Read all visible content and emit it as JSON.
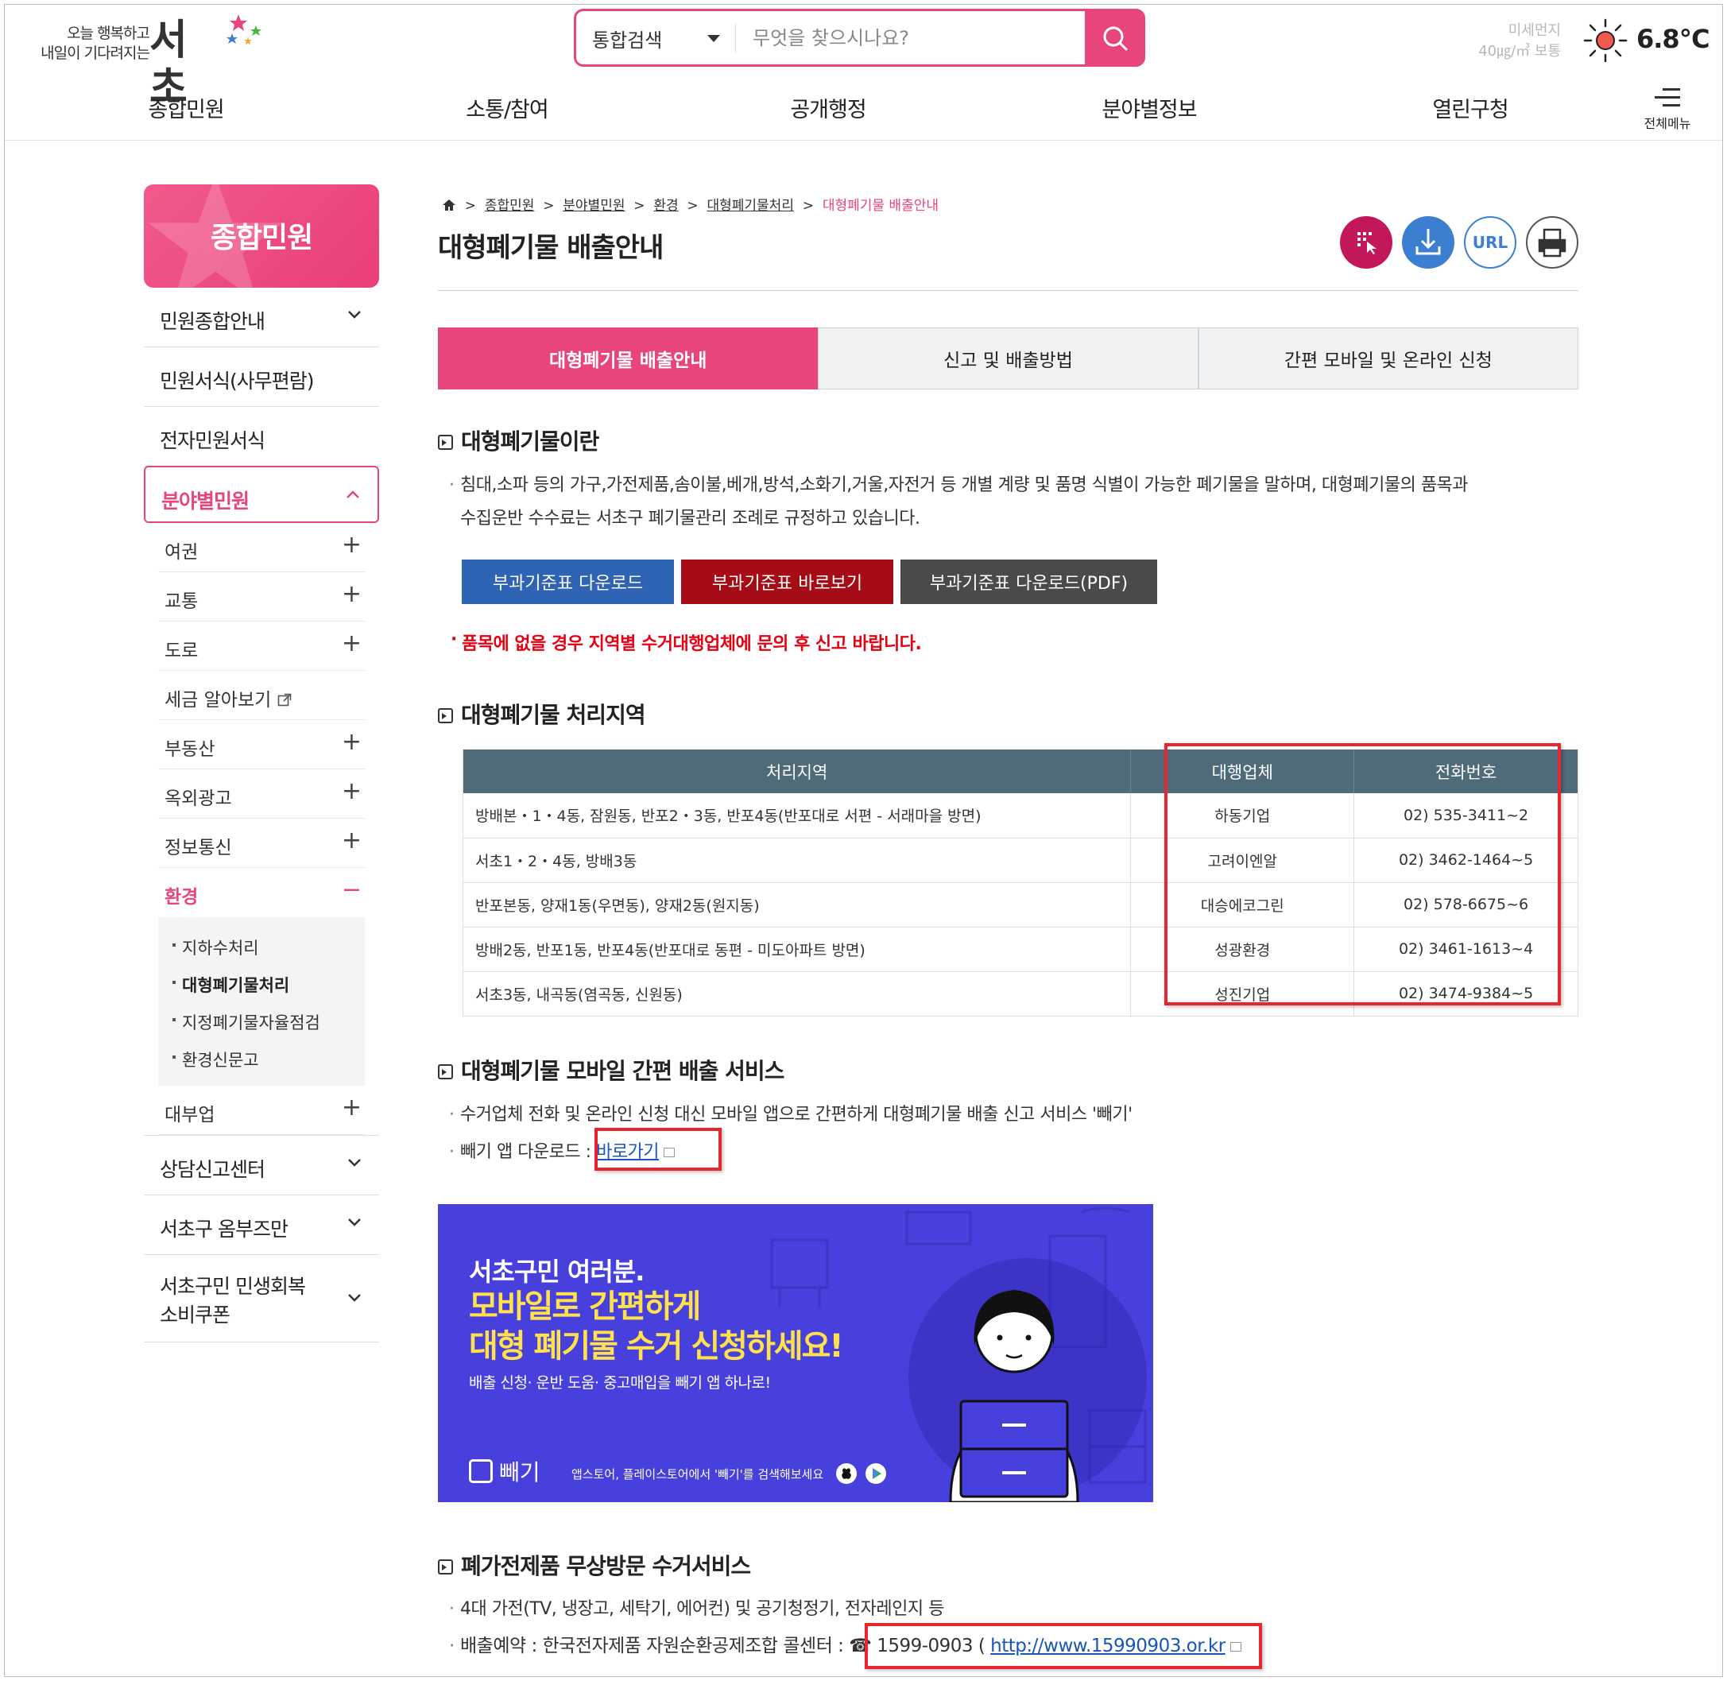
{
  "header": {
    "slogan_line1": "오늘 행복하고",
    "slogan_line2": "내일이 기다려지는",
    "brand": "서초",
    "search": {
      "scope": "통합검색",
      "placeholder": "무엇을 찾으시나요?"
    },
    "dust": {
      "label": "미세먼지",
      "value": "40㎍/㎥ 보통"
    },
    "weather": {
      "temp": "6.8℃"
    },
    "gnb": [
      "종합민원",
      "소통/참여",
      "공개행정",
      "분야별정보",
      "열린구청"
    ],
    "all_menu": "전체메뉴"
  },
  "lnb": {
    "title": "종합민원",
    "items": [
      {
        "label": "민원종합안내"
      },
      {
        "label": "민원서식(사무편람)"
      },
      {
        "label": "전자민원서식"
      },
      {
        "label": "분야별민원"
      }
    ],
    "sub": [
      "여권",
      "교통",
      "도로",
      "세금 알아보기",
      "부동산",
      "옥외광고",
      "정보통신",
      "환경"
    ],
    "env_sub": [
      "지하수처리",
      "대형폐기물처리",
      "지정폐기물자율점검",
      "환경신문고"
    ],
    "after_sub": "대부업",
    "bottom": [
      "상담신고센터",
      "서초구 옴부즈만",
      "서초구민 민생회복",
      "소비쿠폰"
    ]
  },
  "content": {
    "breadcrumb": [
      "종합민원",
      "분야별민원",
      "환경",
      "대형폐기물처리",
      "대형폐기물 배출안내"
    ],
    "title": "대형폐기물 배출안내",
    "util": {
      "url": "URL"
    },
    "tabs": [
      "대형폐기물 배출안내",
      "신고 및 배출방법",
      "간편 모바일 및 온라인 신청"
    ],
    "s1": {
      "title": "대형폐기물이란",
      "text1": "침대,소파 등의 가구,가전제품,솜이불,베개,방석,소화기,거울,자전거 등 개별 계량 및 품명 식별이 가능한 폐기물을 말하며, 대형폐기물의 품목과",
      "text2": "수집운반 수수료는 서초구 폐기물관리 조례로 규정하고 있습니다.",
      "buttons": [
        "부과기준표 다운로드",
        "부과기준표 바로보기",
        "부과기준표 다운로드(PDF)"
      ],
      "notice": "품목에 없을 경우 지역별 수거대행업체에 문의 후 신고 바랍니다."
    },
    "s2": {
      "title": "대형폐기물 처리지역",
      "headers": [
        "처리지역",
        "대행업체",
        "전화번호"
      ],
      "rows": [
        [
          "방배본・1・4동, 잠원동, 반포2・3동, 반포4동(반포대로 서편 - 서래마을 방면)",
          "하동기업",
          "02) 535-3411~2"
        ],
        [
          "서초1・2・4동, 방배3동",
          "고려이엔알",
          "02) 3462-1464~5"
        ],
        [
          "반포본동, 양재1동(우면동), 양재2동(원지동)",
          "대승에코그린",
          "02) 578-6675~6"
        ],
        [
          "방배2동, 반포1동, 반포4동(반포대로 동편 - 미도아파트 방면)",
          "성광환경",
          "02) 3461-1613~4"
        ],
        [
          "서초3동, 내곡동(염곡동, 신원동)",
          "성진기업",
          "02) 3474-9384~5"
        ]
      ]
    },
    "s3": {
      "title": "대형폐기물 모바일 간편 배출 서비스",
      "text1": "수거업체 전화 및 온라인 신청 대신 모바일 앱으로 간편하게 대형폐기물 배출 신고 서비스 '빼기'",
      "text2": "빼기 앱 다운로드 : ",
      "link": "바로가기"
    },
    "banner": {
      "l1": "서초구민 여러분.",
      "l2a": "모바일로 간편하게",
      "l2b": "대형 폐기물 수거 신청하세요!",
      "l3": "배출 신청· 운반 도움· 중고매입을 빼기 앱 하나로!",
      "logo": "빼기",
      "small": "앱스토어, 플레이스토어에서 '빼기'를 검색해보세요"
    },
    "s4": {
      "title": "폐가전제품 무상방문 수거서비스",
      "text1": "4대 가전(TV, 냉장고, 세탁기, 에어컨) 및 공기청정기, 전자레인지 등",
      "text2": "배출예약 : 한국전자제품 자원순환공제조합 콜센터 : ",
      "phone": "☎ 1599-0903 (",
      "url": "http://www.15990903.or.kr"
    }
  }
}
